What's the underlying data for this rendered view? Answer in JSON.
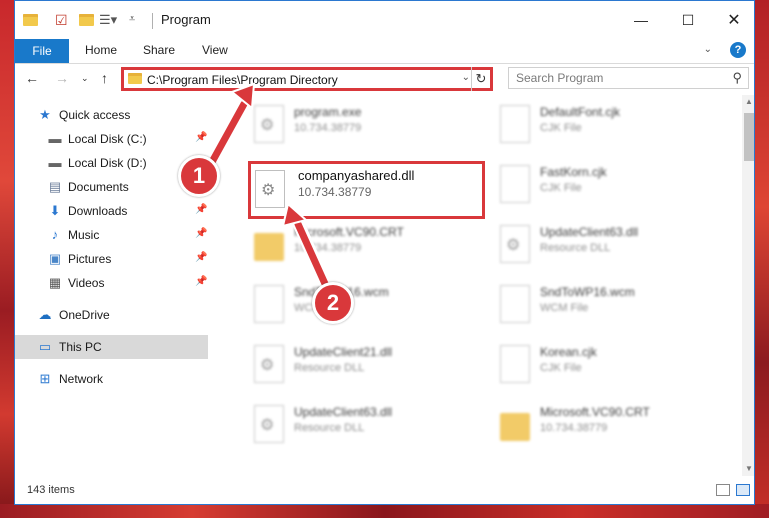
{
  "window": {
    "title": "Program",
    "minimize_icon": "minimize-icon",
    "maximize_icon": "maximize-icon",
    "close_icon": "close-icon"
  },
  "ribbon": {
    "tabs": [
      "File",
      "Home",
      "Share",
      "View"
    ],
    "help_label": "?"
  },
  "address_bar": {
    "path": "C:\\Program Files\\Program Directory"
  },
  "search": {
    "placeholder": "Search Program"
  },
  "sidebar": {
    "items": [
      {
        "label": "Quick access",
        "icon": "star-icon"
      },
      {
        "label": "Local Disk (C:)",
        "icon": "drive-icon",
        "pinned": true
      },
      {
        "label": "Local Disk (D:)",
        "icon": "drive-icon"
      },
      {
        "label": "Documents",
        "icon": "documents-icon",
        "pinned": true
      },
      {
        "label": "Downloads",
        "icon": "downloads-icon",
        "pinned": true
      },
      {
        "label": "Music",
        "icon": "music-icon",
        "pinned": true
      },
      {
        "label": "Pictures",
        "icon": "pictures-icon",
        "pinned": true
      },
      {
        "label": "Videos",
        "icon": "videos-icon",
        "pinned": true
      },
      {
        "label": "OneDrive",
        "icon": "onedrive-icon"
      },
      {
        "label": "This PC",
        "icon": "computer-icon",
        "selected": true
      },
      {
        "label": "Network",
        "icon": "network-icon"
      }
    ]
  },
  "files": {
    "left": [
      {
        "name": "program.exe",
        "sub": "10.734.38779"
      },
      {
        "name": "companyashared.dll",
        "sub": "10.734.38779"
      },
      {
        "name": "Microsoft.VC90.CRT",
        "sub": "10.734.38779"
      },
      {
        "name": "SndToWP16.wcm",
        "sub": "WCM File"
      },
      {
        "name": "UpdateClient21.dll",
        "sub": "Resource DLL"
      },
      {
        "name": "UpdateClient63.dll",
        "sub": "Resource DLL"
      }
    ],
    "right": [
      {
        "name": "DefaultFont.cjk",
        "sub": "CJK File"
      },
      {
        "name": "FastKorn.cjk",
        "sub": "CJK File"
      },
      {
        "name": "UpdateClient63.dll",
        "sub": "Resource DLL"
      },
      {
        "name": "SndToWP16.wcm",
        "sub": "WCM File"
      },
      {
        "name": "Korean.cjk",
        "sub": "CJK File"
      },
      {
        "name": "Microsoft.VC90.CRT",
        "sub": "10.734.38779"
      }
    ]
  },
  "status": {
    "item_count": "143 items"
  },
  "callouts": [
    "1",
    "2"
  ],
  "colors": {
    "accent": "#1979ca",
    "highlight": "#d9383b"
  }
}
